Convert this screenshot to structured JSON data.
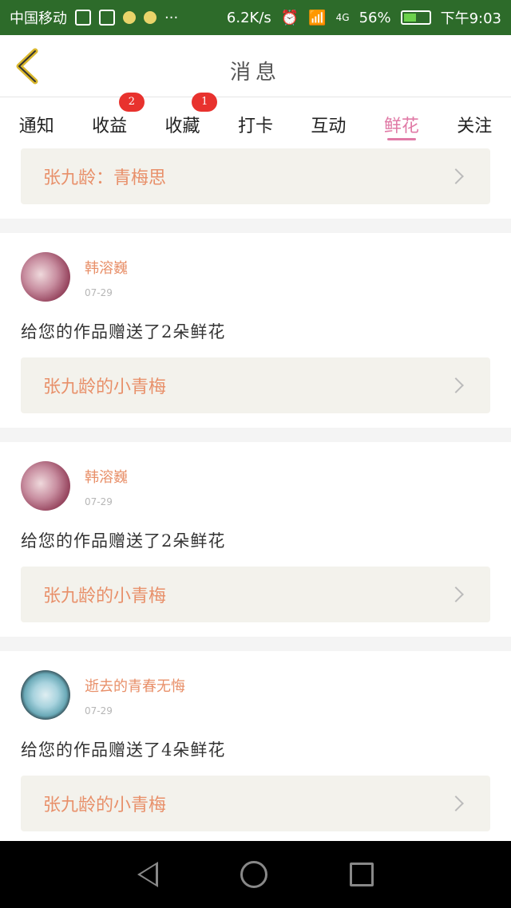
{
  "status_bar": {
    "carrier": "中国移动",
    "net_speed": "6.2K/s",
    "signal_label": "4G",
    "battery": "56%",
    "battery_level": 0.56,
    "time": "下午9:03"
  },
  "header": {
    "title": "消息"
  },
  "tabs": [
    {
      "label": "通知",
      "badge": ""
    },
    {
      "label": "收益",
      "badge": "2"
    },
    {
      "label": "收藏",
      "badge": "1"
    },
    {
      "label": "打卡",
      "badge": ""
    },
    {
      "label": "互动",
      "badge": ""
    },
    {
      "label": "鲜花",
      "badge": "",
      "active": true
    },
    {
      "label": "关注",
      "badge": ""
    }
  ],
  "top_card": {
    "text": "张九龄：青梅思"
  },
  "messages": [
    {
      "username": "韩溶巍",
      "time": "07-29",
      "text": "给您的作品赠送了2朵鲜花",
      "work": "张九龄的小青梅"
    },
    {
      "username": "韩溶巍",
      "time": "07-29",
      "text": "给您的作品赠送了2朵鲜花",
      "work": "张九龄的小青梅"
    },
    {
      "username": "逝去的青春无悔",
      "time": "07-29",
      "text": "给您的作品赠送了4朵鲜花",
      "work": "张九龄的小青梅"
    }
  ],
  "colors": {
    "status_bar_bg": "#2d6b2a",
    "accent_pink": "#e07aa6",
    "gift_text": "#e8906a",
    "badge_red": "#e8322e"
  },
  "icons": {
    "back": "chevron-left-icon",
    "card_arrow": "chevron-right-icon",
    "nav_back": "triangle-back-icon",
    "nav_home": "circle-home-icon",
    "nav_recent": "square-recent-icon"
  }
}
